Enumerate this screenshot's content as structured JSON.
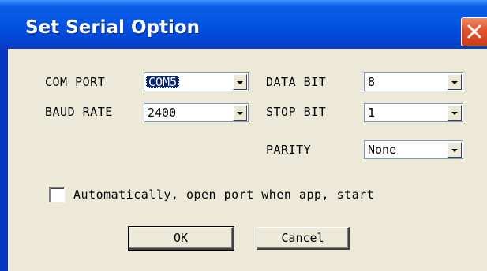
{
  "dialog": {
    "title": "Set Serial Option",
    "close_icon": "close-icon"
  },
  "fields": {
    "com_port": {
      "label": "COM PORT",
      "value": "COM5"
    },
    "baud_rate": {
      "label": "BAUD RATE",
      "value": "2400"
    },
    "data_bit": {
      "label": "DATA BIT",
      "value": "8"
    },
    "stop_bit": {
      "label": "STOP BIT",
      "value": "1"
    },
    "parity": {
      "label": "PARITY",
      "value": "None"
    }
  },
  "auto_open": {
    "label": "Automatically, open port when app, start",
    "checked": false
  },
  "buttons": {
    "ok": "OK",
    "cancel": "Cancel"
  },
  "colors": {
    "title_bar": "#0356e2",
    "dialog_bg": "#ece9d8",
    "close_button": "#e2552f",
    "selection": "#0a246a"
  }
}
